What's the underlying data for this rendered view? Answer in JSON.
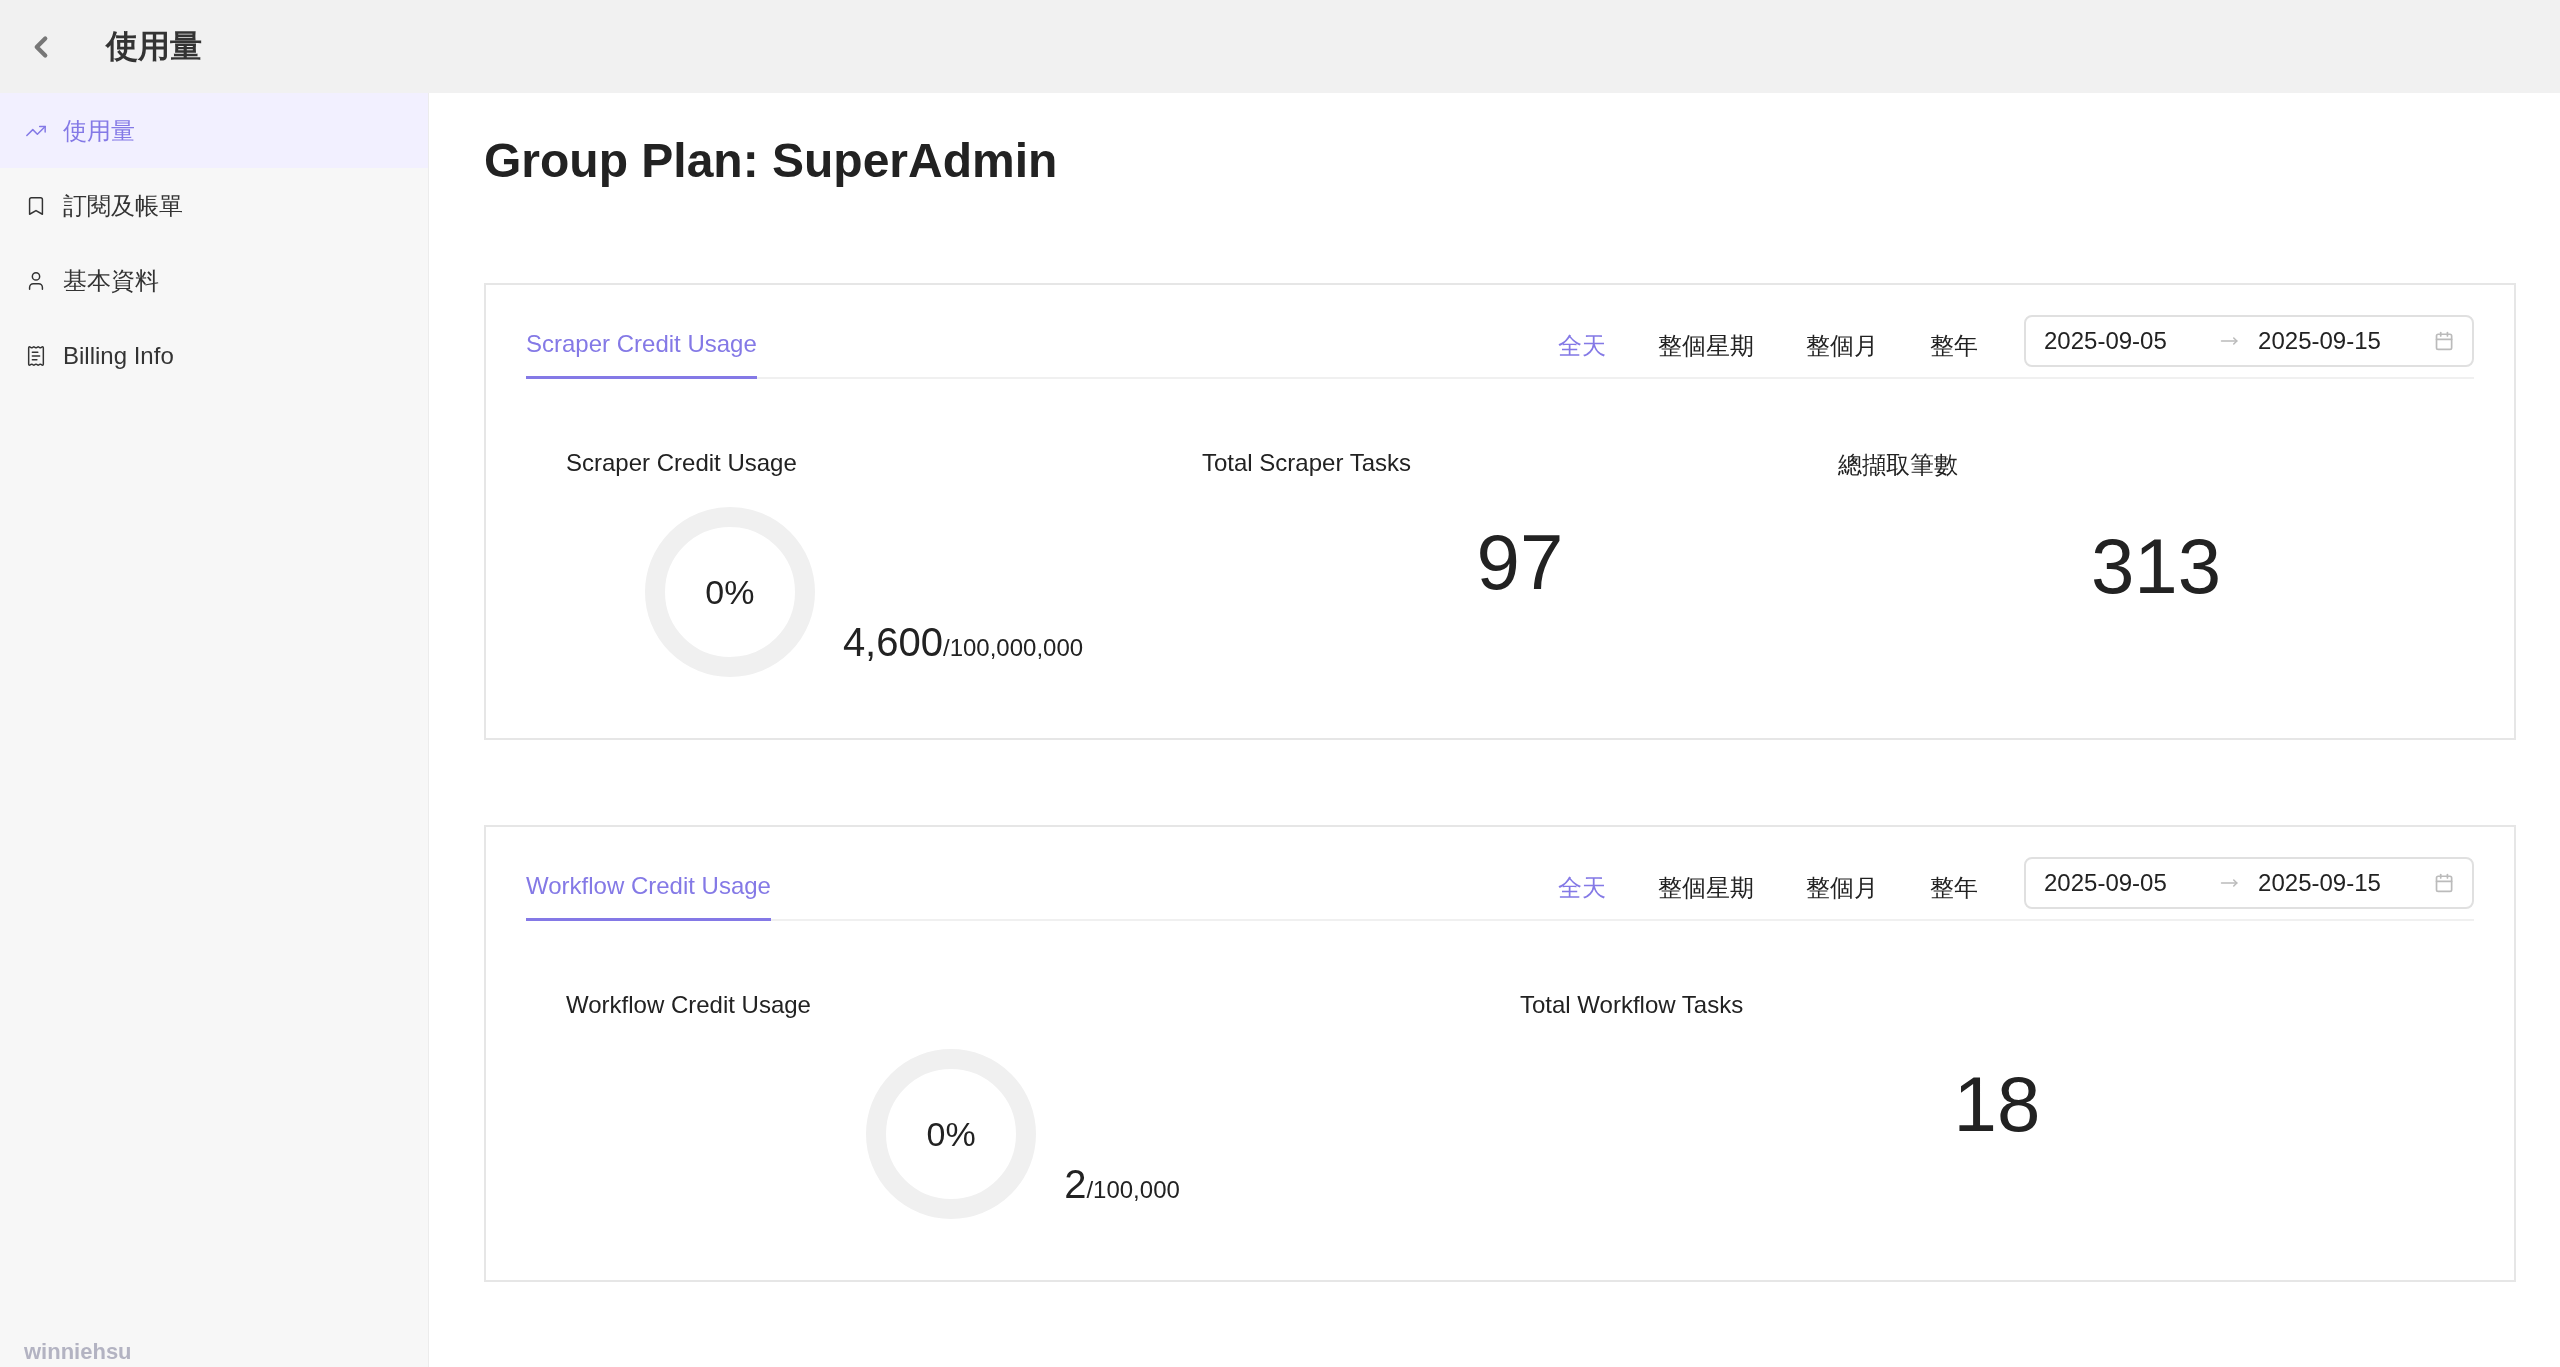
{
  "header": {
    "title": "使用量"
  },
  "sidebar": {
    "items": [
      {
        "label": "使用量",
        "selected": true
      },
      {
        "label": "訂閱及帳單",
        "selected": false
      },
      {
        "label": "基本資料",
        "selected": false
      },
      {
        "label": "Billing Info",
        "selected": false
      }
    ],
    "user": "winniehsu"
  },
  "page_title": "Group Plan: SuperAdmin",
  "cards": [
    {
      "tabs": [
        {
          "label": "Scraper Credit Usage",
          "selected": true
        }
      ],
      "ranges": [
        {
          "label": "全天",
          "selected": true
        },
        {
          "label": "整個星期",
          "selected": false
        },
        {
          "label": "整個月",
          "selected": false
        },
        {
          "label": "整年",
          "selected": false
        }
      ],
      "date_start": "2025-09-05",
      "date_end": "2025-09-15",
      "stats": [
        {
          "kind": "donut",
          "label": "Scraper Credit Usage",
          "percent": "0%",
          "used": "4,600",
          "total": "/100,000,000"
        },
        {
          "kind": "number",
          "label": "Total Scraper Tasks",
          "value": "97"
        },
        {
          "kind": "number",
          "label": "總擷取筆數",
          "value": "313"
        }
      ]
    },
    {
      "tabs": [
        {
          "label": "Workflow Credit Usage",
          "selected": true
        }
      ],
      "ranges": [
        {
          "label": "全天",
          "selected": true
        },
        {
          "label": "整個星期",
          "selected": false
        },
        {
          "label": "整個月",
          "selected": false
        },
        {
          "label": "整年",
          "selected": false
        }
      ],
      "date_start": "2025-09-05",
      "date_end": "2025-09-15",
      "stats": [
        {
          "kind": "donut",
          "label": "Workflow Credit Usage",
          "percent": "0%",
          "used": "2",
          "total": "/100,000"
        },
        {
          "kind": "number",
          "label": "Total Workflow Tasks",
          "value": "18"
        }
      ]
    }
  ]
}
